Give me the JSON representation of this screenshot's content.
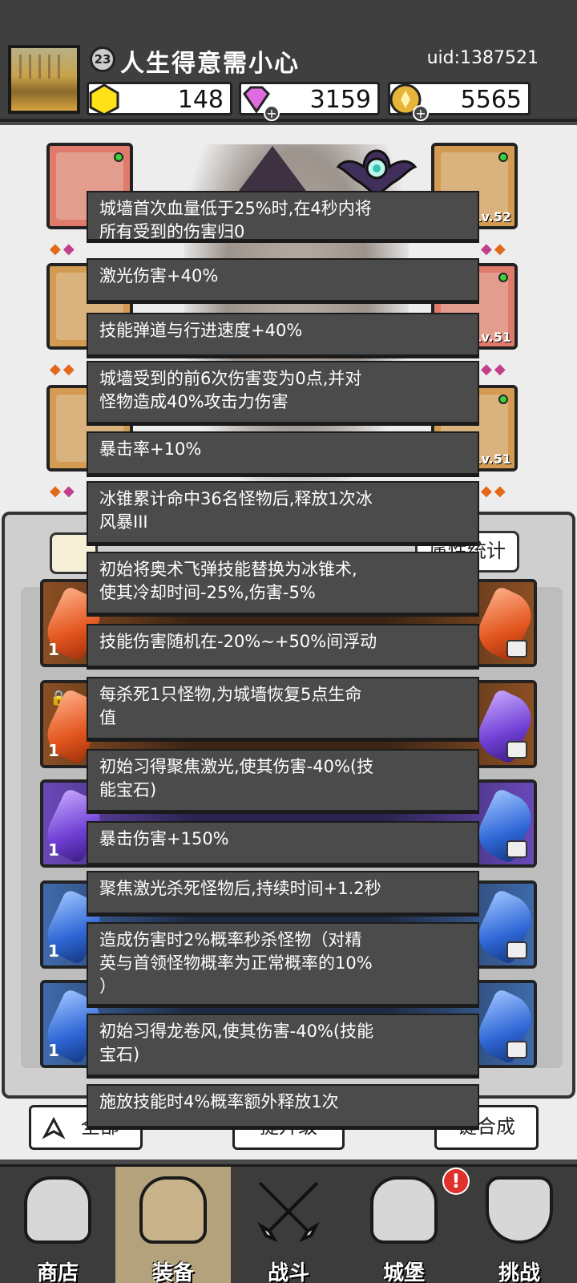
{
  "header": {
    "avatar_alt": "player avatar",
    "level": "23",
    "player_name": "人生得意需小心",
    "uid": "uid:1387521",
    "currencies": [
      {
        "icon": "yellow-gem-icon",
        "value": "148",
        "has_plus": false
      },
      {
        "icon": "purple-diamond-icon",
        "value": "3159",
        "has_plus": true
      },
      {
        "icon": "gold-coin-icon",
        "value": "5565",
        "has_plus": true
      }
    ]
  },
  "equipment": {
    "slots": [
      {
        "name": "helmet-slot",
        "level": ""
      },
      {
        "name": "weapon-slot",
        "level": "Lv.52"
      },
      {
        "name": "armor-slot",
        "level": ""
      },
      {
        "name": "scarf-slot",
        "level": "Lv.51"
      },
      {
        "name": "boots-slot",
        "level": ""
      },
      {
        "name": "accessory-slot",
        "level": "Lv.51"
      }
    ]
  },
  "inventory": {
    "stat_button_label": "属性统计",
    "row_counts": [
      "1",
      "1",
      "1",
      "1",
      "1"
    ],
    "bottom_buttons": {
      "filter_label": "全部",
      "upgrade_label": "提升级",
      "merge_label": "键合成"
    }
  },
  "tooltips": [
    [
      "城墙首次血量低于25%时,在4秒内将",
      "所有受到的伤害归0"
    ],
    [
      "激光伤害+40%"
    ],
    [
      "技能弹道与行进速度+40%"
    ],
    [
      "城墙受到的前6次伤害变为0点,并对",
      "怪物造成40%攻击力伤害"
    ],
    [
      "暴击率+10%"
    ],
    [
      "冰锥累计命中36名怪物后,释放1次冰",
      "风暴III"
    ],
    [
      "初始将奥术飞弹技能替换为冰锥术,",
      "使其冷却时间-25%,伤害-5%"
    ],
    [
      "技能伤害随机在-20%~+50%间浮动"
    ],
    [
      "每杀死1只怪物,为城墙恢复5点生命",
      "值"
    ],
    [
      "初始习得聚焦激光,使其伤害-40%(技",
      "能宝石)"
    ],
    [
      "暴击伤害+150%"
    ],
    [
      "聚焦激光杀死怪物后,持续时间+1.2秒"
    ],
    [
      "造成伤害时2%概率秒杀怪物（对精",
      "英与首领怪物概率为正常概率的10%",
      "）"
    ],
    [
      "初始习得龙卷风,使其伤害-40%(技能",
      "宝石)"
    ],
    [
      "施放技能时4%概率额外释放1次"
    ]
  ],
  "nav": {
    "items": [
      {
        "label": "商店",
        "icon": "shop-icon",
        "active": false
      },
      {
        "label": "装备",
        "icon": "backpack-icon",
        "active": true
      },
      {
        "label": "战斗",
        "icon": "crossed-swords-icon",
        "active": false
      },
      {
        "label": "城堡",
        "icon": "castle-icon",
        "active": false
      },
      {
        "label": "挑战",
        "icon": "shield-icon",
        "active": false
      }
    ],
    "alert_badge": "!"
  },
  "colors": {
    "tooltip_bg": "#4b4b4b",
    "nav_active": "#b4a27c",
    "alert": "#e0302b"
  }
}
